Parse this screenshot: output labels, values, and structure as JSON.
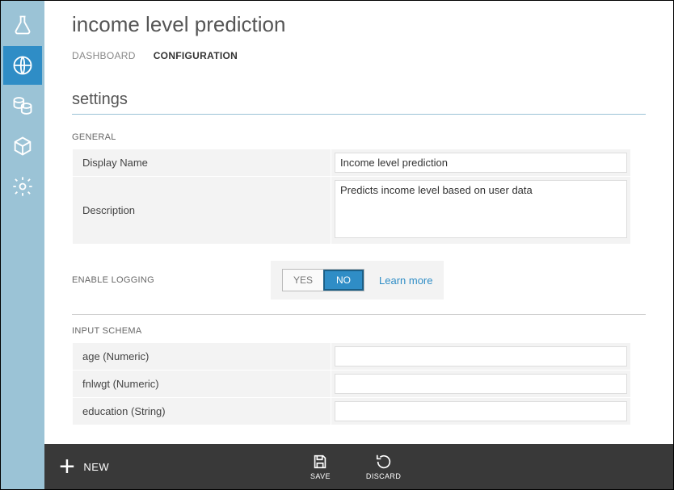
{
  "page": {
    "title": "income level prediction"
  },
  "tabs": {
    "dashboard": "DASHBOARD",
    "configuration": "CONFIGURATION"
  },
  "settings": {
    "heading": "settings",
    "general_label": "GENERAL",
    "display_name_label": "Display Name",
    "display_name_value": "Income level prediction",
    "description_label": "Description",
    "description_value": "Predicts income level based on user data",
    "logging_label": "ENABLE LOGGING",
    "toggle_yes": "YES",
    "toggle_no": "NO",
    "learn_more": "Learn more",
    "input_schema_label": "INPUT SCHEMA",
    "schema": [
      "age (Numeric)",
      "fnlwgt (Numeric)",
      "education (String)"
    ]
  },
  "footer": {
    "new": "NEW",
    "save": "SAVE",
    "discard": "DISCARD"
  }
}
